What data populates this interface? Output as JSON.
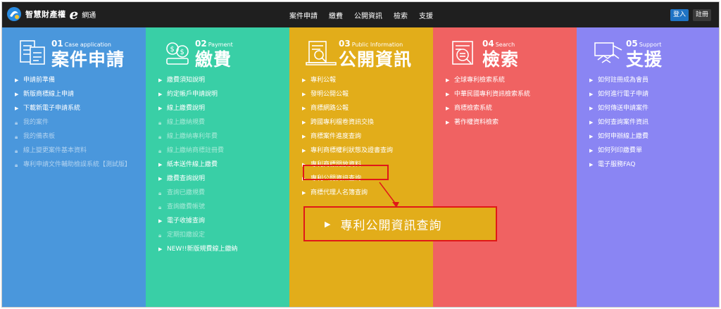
{
  "header": {
    "site_name": "智慧財產權",
    "logo_letter": "e",
    "logo_suffix": "網通",
    "nav": [
      "案件申請",
      "繳費",
      "公開資訊",
      "檢索",
      "支援"
    ],
    "login": "登入",
    "register": "註冊"
  },
  "columns": [
    {
      "num": "01",
      "eng": "Case application",
      "title": "案件申請",
      "color": "#4a97dc",
      "icon": "forms-icon",
      "items": [
        {
          "label": "申請前準備",
          "locked": false
        },
        {
          "label": "新版商標線上申請",
          "locked": false
        },
        {
          "label": "下載新電子申請系統",
          "locked": false
        },
        {
          "label": "我的案件",
          "locked": true
        },
        {
          "label": "我的備表板",
          "locked": true
        },
        {
          "label": "線上變更案件基本資料",
          "locked": true
        },
        {
          "label": "專利申請文件輔助檢誤系統【測試版】",
          "locked": true
        }
      ]
    },
    {
      "num": "02",
      "eng": "Payment",
      "title": "繳費",
      "color": "#39cfa6",
      "icon": "coins-icon",
      "items": [
        {
          "label": "繳費須知說明",
          "locked": false
        },
        {
          "label": "約定帳戶申請說明",
          "locked": false
        },
        {
          "label": "線上繳費說明",
          "locked": false
        },
        {
          "label": "線上繳納規費",
          "locked": true
        },
        {
          "label": "線上繳納專利年費",
          "locked": true
        },
        {
          "label": "線上繳納商標註冊費",
          "locked": true
        },
        {
          "label": "紙本送件線上繳費",
          "locked": false
        },
        {
          "label": "繳費查詢說明",
          "locked": false
        },
        {
          "label": "查詢已繳規費",
          "locked": true
        },
        {
          "label": "查詢繳費帳號",
          "locked": true
        },
        {
          "label": "電子收據查詢",
          "locked": false
        },
        {
          "label": "定期扣繳設定",
          "locked": true
        },
        {
          "label": "NEW!!新版規費線上繳納",
          "locked": false
        }
      ]
    },
    {
      "num": "03",
      "eng": "Public Information",
      "title": "公開資訊",
      "color": "#e2ad1a",
      "icon": "document-search-icon",
      "items": [
        {
          "label": "專利公報",
          "locked": false
        },
        {
          "label": "發明公開公報",
          "locked": false
        },
        {
          "label": "商標網路公報",
          "locked": false
        },
        {
          "label": "跨國專利檔卷資訊交換",
          "locked": false
        },
        {
          "label": "商標案件進度查詢",
          "locked": false
        },
        {
          "label": "專利商標權利狀態及證書查詢",
          "locked": false
        },
        {
          "label": "專利商標開放資料",
          "locked": false
        },
        {
          "label": "專利公開資訊查詢",
          "locked": false
        },
        {
          "label": "商標代理人名簿查詢",
          "locked": false
        }
      ]
    },
    {
      "num": "04",
      "eng": "Search",
      "title": "檢索",
      "color": "#f06262",
      "icon": "magnifier-doc-icon",
      "items": [
        {
          "label": "全球專利檢索系統",
          "locked": false
        },
        {
          "label": "中華民國專利資訊檢索系統",
          "locked": false
        },
        {
          "label": "商標檢索系統",
          "locked": false
        },
        {
          "label": "著作權資料檢索",
          "locked": false
        }
      ]
    },
    {
      "num": "05",
      "eng": "Support",
      "title": "支援",
      "color": "#8a85f3",
      "icon": "handshake-icon",
      "items": [
        {
          "label": "如何註冊成為會員",
          "locked": false
        },
        {
          "label": "如何進行電子申請",
          "locked": false
        },
        {
          "label": "如何傳送申請案件",
          "locked": false
        },
        {
          "label": "如何查詢案件資訊",
          "locked": false
        },
        {
          "label": "如何申辦線上繳費",
          "locked": false
        },
        {
          "label": "如何列印繳費單",
          "locked": false
        },
        {
          "label": "電子服務FAQ",
          "locked": false
        }
      ]
    }
  ],
  "callout": {
    "label": "專利公開資訊查詢"
  }
}
